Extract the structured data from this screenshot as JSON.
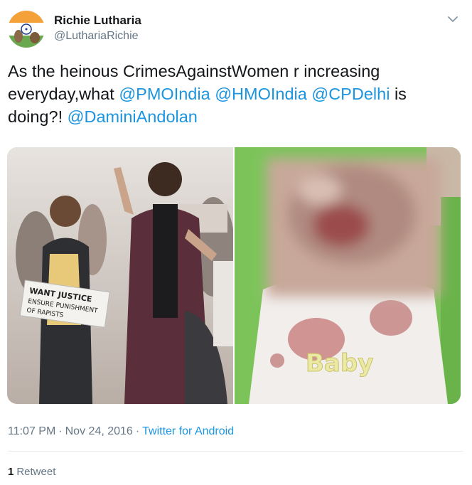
{
  "user": {
    "name": "Richie Lutharia",
    "handle": "@LuthariaRichie"
  },
  "tweet": {
    "text_parts": [
      {
        "text": "As the heinous CrimesAgainstWomen r increasing everyday,what ",
        "mention": false
      },
      {
        "text": "@PMOIndia",
        "mention": true
      },
      {
        "text": " ",
        "mention": false
      },
      {
        "text": "@HMOIndia",
        "mention": true
      },
      {
        "text": " ",
        "mention": false
      },
      {
        "text": "@CPDelhi",
        "mention": true
      },
      {
        "text": " is doing?! ",
        "mention": false
      },
      {
        "text": "@DaminiAndolan",
        "mention": true
      }
    ],
    "sign_text": [
      "WANT JUSTICE",
      "ENSURE PUNISHMENT",
      "OF RAPISTS"
    ],
    "bib_text": "Baby"
  },
  "meta": {
    "time": "11:07 PM",
    "separator": "·",
    "date": "Nov 24, 2016",
    "source": "Twitter for Android"
  },
  "stats": {
    "retweet_count": "1",
    "retweet_label": "Retweet"
  },
  "colors": {
    "link": "#1b95e0",
    "text": "#14171a",
    "secondary": "#657786",
    "divider": "#e6ecf0"
  },
  "icons": {
    "caret": "chevron-down-icon",
    "avatar": "india-flag-avatar"
  }
}
